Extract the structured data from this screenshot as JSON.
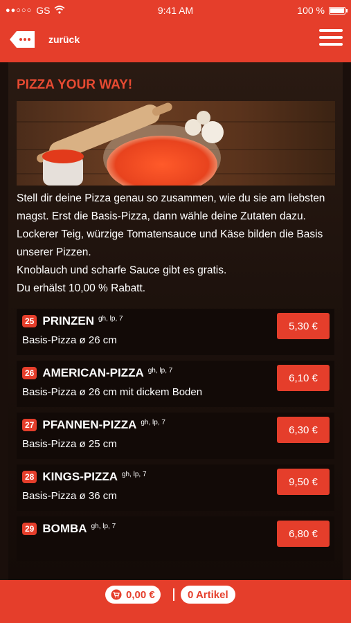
{
  "status_bar": {
    "signal_dots": "●●○○○",
    "carrier": "GS",
    "time": "9:41 AM",
    "battery_text": "100 %",
    "battery_level": 1.0,
    "wifi_icon": "wifi-icon"
  },
  "navbar": {
    "back_label": "zurück",
    "back_icon": "ellipsis-back-icon",
    "menu_icon": "hamburger-icon"
  },
  "page": {
    "heading": "PIZZA YOUR WAY!",
    "description": [
      "Stell dir deine Pizza genau so zusammen, wie du sie am liebsten magst. Erst die Basis-Pizza, dann wähle deine Zutaten dazu.",
      "Lockerer Teig, würzige Tomatensauce und Käse bilden die Basis unserer Pizzen.",
      "Knoblauch und scharfe Sauce gibt es gratis.",
      "Du erhälst 10,00 % Rabatt."
    ]
  },
  "items": [
    {
      "number": "25",
      "name": "PRINZEN",
      "allergens": "gh, lp, 7",
      "desc": "Basis-Pizza ø 26 cm",
      "price": "5,30 €"
    },
    {
      "number": "26",
      "name": "AMERICAN-PIZZA",
      "allergens": "gh, lp, 7",
      "desc": "Basis-Pizza ø 26 cm mit dickem Boden",
      "price": "6,10 €"
    },
    {
      "number": "27",
      "name": "PFANNEN-PIZZA",
      "allergens": "gh, lp, 7",
      "desc": "Basis-Pizza ø 25 cm",
      "price": "6,30 €"
    },
    {
      "number": "28",
      "name": "KINGS-PIZZA",
      "allergens": "gh, lp, 7",
      "desc": "Basis-Pizza ø 36 cm",
      "price": "9,50 €"
    },
    {
      "number": "29",
      "name": "BOMBA",
      "allergens": "gh, lp, 7",
      "desc": "",
      "price": "6,80 €"
    }
  ],
  "bottom_bar": {
    "cart_total": "0,00 €",
    "cart_icon": "cart-icon",
    "articles": "0 Artikel"
  },
  "colors": {
    "accent": "#e53e2b",
    "heading": "#e74a32",
    "background": "#1a0f0b"
  }
}
